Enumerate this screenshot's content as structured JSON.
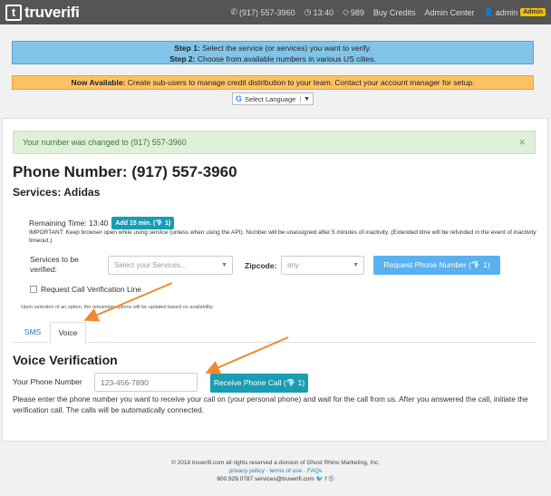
{
  "navbar": {
    "brand_mark": "t",
    "brand_name": "truverifi",
    "phone": "(917) 557-3960",
    "time": "13:40",
    "credits": "989",
    "buy_credits": "Buy Credits",
    "admin_center": "Admin Center",
    "user": "admin",
    "user_badge": "Admin"
  },
  "steps": {
    "step1_bold": "Step 1:",
    "step1_text": " Select the service (or services) you want to verify.",
    "step2_bold": "Step 2:",
    "step2_text": " Choose from available numbers in various US cities."
  },
  "notice": {
    "bold": "Now Available:",
    "text": " Create sub-users to manage credit distribution to your team. Contact your account manager for setup."
  },
  "language": {
    "label": "Select Language",
    "arrow": "▼"
  },
  "success_alert": {
    "text": "Your number was changed to (917) 557-3960",
    "close": "×"
  },
  "page": {
    "title": "Phone Number: (917) 557-3960",
    "services": "Services: Adidas",
    "remaining_time": "Remaining Time: 13:40",
    "add_button": "Add 15 min. (💎 1)",
    "important": "IMPORTANT: Keep browser open while using service (unless when using the API). Number will be unassigned after 5 minutes of inactivity. (Extended time will be refunded in the event of inactivity timeout.)"
  },
  "form": {
    "services_label_1": "Services to be",
    "services_label_2": "verified:",
    "services_placeholder": "Select your Services...",
    "zipcode_label": "Zipcode:",
    "zipcode_value": "any",
    "request_button": "Request Phone Number (💎 1)",
    "call_verification_label": "Request Call Verification Line",
    "upon_selection_note": "Upon selection of an option, the remaining options will be updated based on availability."
  },
  "tabs": [
    {
      "label": "SMS",
      "active": false
    },
    {
      "label": "Voice",
      "active": true
    }
  ],
  "voice": {
    "title": "Voice Verification",
    "phone_label": "Your Phone Number",
    "phone_placeholder": "123-456-7890",
    "receive_button": "Receive Phone Call (💎 1)",
    "instructions": "Please enter the phone number you want to receive your call on (your personal phone) and wait for the call from us. After you answered the call, initiate the verification call. The calls will be automatically connected."
  },
  "footer": {
    "copyright": "© 2018 truverifi.com  all rights reserved  a division of Ghost Rhino Marketing, Inc.",
    "privacy": "privacy policy",
    "terms": "terms of use",
    "faqs": "FAQs",
    "phone": "800.929.0787",
    "email": "services@truverifi.com",
    "social": "🐦 f Ⓢ"
  },
  "colors": {
    "navbar": "#555555",
    "step_box": "#82c4e8",
    "notice_box": "#ffc266",
    "primary_button": "#5bb0f0",
    "teal_button": "#1a9db0",
    "arrow": "#f08a30"
  }
}
